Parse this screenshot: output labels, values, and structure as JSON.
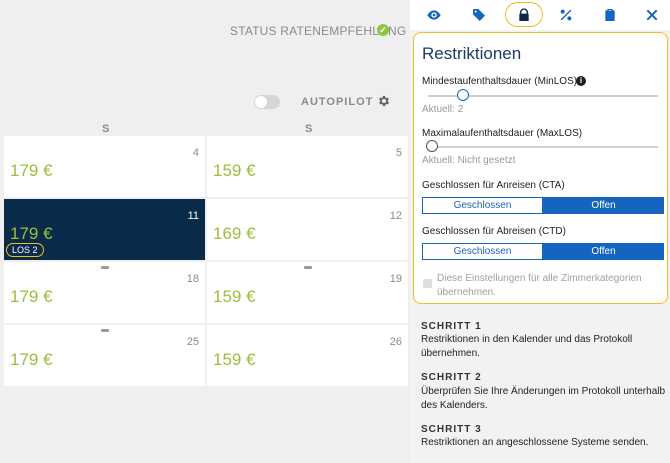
{
  "status": {
    "label": "STATUS RATENEMPFEHLUNG"
  },
  "autopilot": {
    "label": "AUTOPILOT",
    "enabled": false
  },
  "calendar": {
    "columns": [
      "S",
      "S"
    ],
    "cells": [
      {
        "day": "4",
        "price": "179 €"
      },
      {
        "day": "5",
        "price": "159 €"
      },
      {
        "day": "11",
        "price": "179 €",
        "badge": "LOS 2"
      },
      {
        "day": "12",
        "price": "169 €"
      },
      {
        "day": "18",
        "price": "179 €"
      },
      {
        "day": "19",
        "price": "159 €"
      },
      {
        "day": "25",
        "price": "179 €"
      },
      {
        "day": "26",
        "price": "159 €"
      }
    ],
    "colors": {
      "selected": "#0a2a4a",
      "price": "#9bbf3c",
      "marker_yellow": "#f0c020",
      "marker_grey": "#9a9a9a"
    }
  },
  "toolbar": {
    "icons": [
      "eye-icon",
      "tag-icon",
      "lock-icon",
      "percent-icon",
      "clipboard-icon",
      "close-icon"
    ],
    "active": "lock-icon"
  },
  "restrictions": {
    "title": "Restriktionen",
    "minlos": {
      "label": "Mindestaufenthaltsdauer (MinLOS)",
      "current": "Aktuell: 2",
      "value": 2
    },
    "maxlos": {
      "label": "Maximalaufenthaltsdauer (MaxLOS)",
      "current": "Aktuell: Nicht gesetzt"
    },
    "cta": {
      "label": "Geschlossen für Anreisen (CTA)",
      "closed": "Geschlossen",
      "open": "Offen",
      "selected": "Offen"
    },
    "ctd": {
      "label": "Geschlossen für Abreisen (CTD)",
      "closed": "Geschlossen",
      "open": "Offen",
      "selected": "Offen"
    },
    "apply_all": {
      "label": "Diese Einstellungen für alle Zimmerkategorien übernehmen.",
      "checked": false
    }
  },
  "steps": [
    {
      "title": "SCHRITT 1",
      "text": "Restriktionen in den Kalender und das Protokoll übernehmen."
    },
    {
      "title": "SCHRITT 2",
      "text": "Überprüfen Sie Ihre Änderungen im Protokoll unterhalb des Kalenders."
    },
    {
      "title": "SCHRITT 3",
      "text": "Restriktionen an angeschlossene Systeme senden."
    }
  ],
  "accent": "#1565c0",
  "highlight": "#f0c020"
}
